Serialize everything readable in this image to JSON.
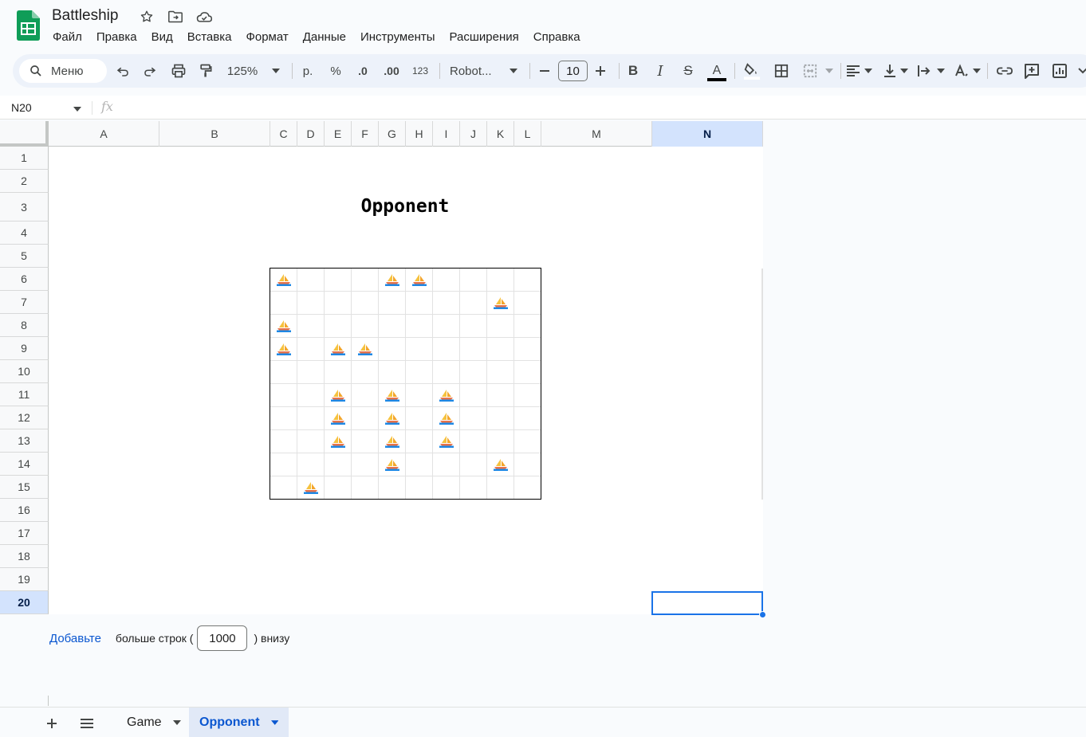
{
  "document": {
    "title": "Battleship"
  },
  "menu": [
    "Файл",
    "Правка",
    "Вид",
    "Вставка",
    "Формат",
    "Данные",
    "Инструменты",
    "Расширения",
    "Справка"
  ],
  "toolbar": {
    "search_label": "Меню",
    "zoom": "125%",
    "currency": "р.",
    "percent": "%",
    "decrease_decimal": ".0",
    "increase_decimal": ".00",
    "number_format": "123",
    "font": "Robot...",
    "font_size": "10",
    "text_color": "#000000"
  },
  "formula_bar": {
    "cell_reference": "N20",
    "fx": "fx"
  },
  "columns": [
    "A",
    "B",
    "C",
    "D",
    "E",
    "F",
    "G",
    "H",
    "I",
    "J",
    "K",
    "L",
    "M",
    "N"
  ],
  "selected_column": "N",
  "rows": [
    "1",
    "2",
    "3",
    "4",
    "5",
    "6",
    "7",
    "8",
    "9",
    "10",
    "11",
    "12",
    "13",
    "14",
    "15",
    "16",
    "17",
    "18",
    "19",
    "20"
  ],
  "selected_row": "20",
  "sheet": {
    "heading": "Opponent",
    "board_columns": [
      "C",
      "D",
      "E",
      "F",
      "G",
      "H",
      "I",
      "J",
      "K",
      "L"
    ],
    "board_rows": [
      "6",
      "7",
      "8",
      "9",
      "10",
      "11",
      "12",
      "13",
      "14",
      "15"
    ],
    "ship_glyph": "⛵",
    "ship_cells": [
      "C6",
      "G6",
      "H6",
      "K7",
      "C8",
      "C9",
      "E9",
      "F9",
      "E11",
      "G11",
      "I11",
      "E12",
      "G12",
      "I12",
      "E13",
      "G13",
      "I13",
      "G14",
      "K14",
      "D15"
    ]
  },
  "add_rows": {
    "link": "Добавьте",
    "prefix": "больше строк (",
    "count": "1000",
    "suffix": ") внизу"
  },
  "tabs": [
    {
      "label": "Game",
      "active": false
    },
    {
      "label": "Opponent",
      "active": true
    }
  ],
  "colors": {
    "accent": "#0b57d0",
    "selection": "#1a73e8",
    "header_selected": "#d3e3fd",
    "sheets_green": "#0f9d58"
  }
}
